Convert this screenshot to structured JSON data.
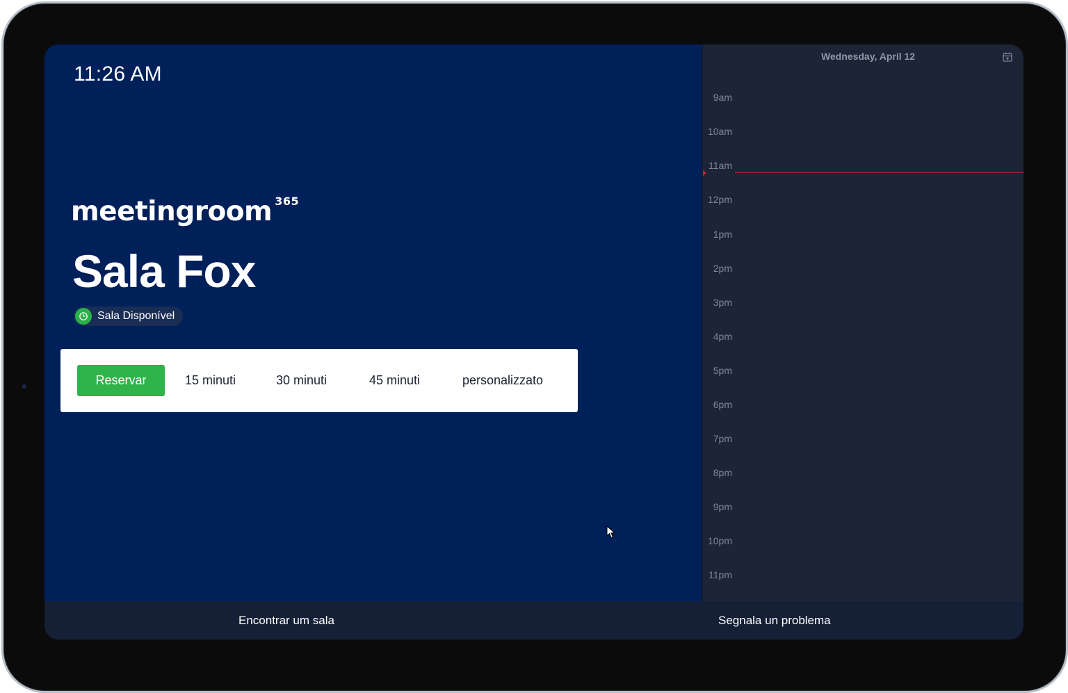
{
  "header": {
    "time": "11:26 AM"
  },
  "brand": {
    "name": "meetingroom",
    "suffix": "365"
  },
  "room": {
    "name": "Sala Fox",
    "status": "Sala Disponível",
    "status_color": "#29b14a"
  },
  "booking": {
    "reserve_label": "Reservar",
    "durations": [
      "15 minuti",
      "30 minuti",
      "45 minuti",
      "personalizzato"
    ],
    "accent_color": "#2fb34a"
  },
  "calendar": {
    "date": "Wednesday, April 12",
    "hours": [
      "9am",
      "10am",
      "11am",
      "12pm",
      "1pm",
      "2pm",
      "3pm",
      "4pm",
      "5pm",
      "6pm",
      "7pm",
      "8pm",
      "9pm",
      "10pm",
      "11pm"
    ],
    "now_line_color": "#c4222a"
  },
  "footer": {
    "find_room": "Encontrar um sala",
    "report_problem": "Segnala un problema"
  }
}
